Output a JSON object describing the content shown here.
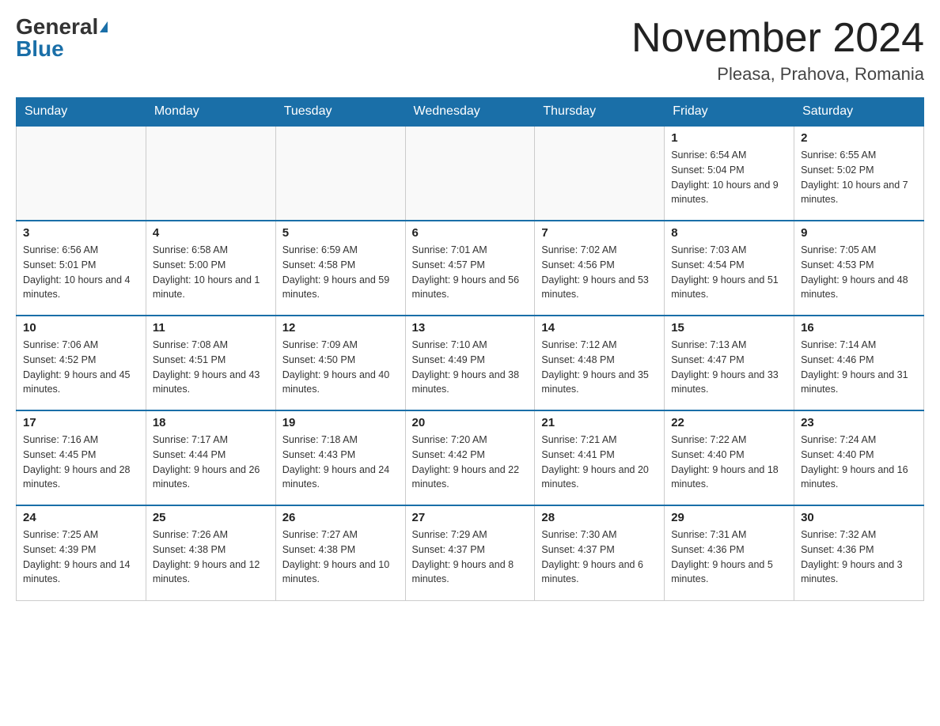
{
  "header": {
    "logo_general": "General",
    "logo_blue": "Blue",
    "month_title": "November 2024",
    "location": "Pleasa, Prahova, Romania"
  },
  "weekdays": [
    "Sunday",
    "Monday",
    "Tuesday",
    "Wednesday",
    "Thursday",
    "Friday",
    "Saturday"
  ],
  "weeks": [
    [
      {
        "day": "",
        "info": ""
      },
      {
        "day": "",
        "info": ""
      },
      {
        "day": "",
        "info": ""
      },
      {
        "day": "",
        "info": ""
      },
      {
        "day": "",
        "info": ""
      },
      {
        "day": "1",
        "info": "Sunrise: 6:54 AM\nSunset: 5:04 PM\nDaylight: 10 hours and 9 minutes."
      },
      {
        "day": "2",
        "info": "Sunrise: 6:55 AM\nSunset: 5:02 PM\nDaylight: 10 hours and 7 minutes."
      }
    ],
    [
      {
        "day": "3",
        "info": "Sunrise: 6:56 AM\nSunset: 5:01 PM\nDaylight: 10 hours and 4 minutes."
      },
      {
        "day": "4",
        "info": "Sunrise: 6:58 AM\nSunset: 5:00 PM\nDaylight: 10 hours and 1 minute."
      },
      {
        "day": "5",
        "info": "Sunrise: 6:59 AM\nSunset: 4:58 PM\nDaylight: 9 hours and 59 minutes."
      },
      {
        "day": "6",
        "info": "Sunrise: 7:01 AM\nSunset: 4:57 PM\nDaylight: 9 hours and 56 minutes."
      },
      {
        "day": "7",
        "info": "Sunrise: 7:02 AM\nSunset: 4:56 PM\nDaylight: 9 hours and 53 minutes."
      },
      {
        "day": "8",
        "info": "Sunrise: 7:03 AM\nSunset: 4:54 PM\nDaylight: 9 hours and 51 minutes."
      },
      {
        "day": "9",
        "info": "Sunrise: 7:05 AM\nSunset: 4:53 PM\nDaylight: 9 hours and 48 minutes."
      }
    ],
    [
      {
        "day": "10",
        "info": "Sunrise: 7:06 AM\nSunset: 4:52 PM\nDaylight: 9 hours and 45 minutes."
      },
      {
        "day": "11",
        "info": "Sunrise: 7:08 AM\nSunset: 4:51 PM\nDaylight: 9 hours and 43 minutes."
      },
      {
        "day": "12",
        "info": "Sunrise: 7:09 AM\nSunset: 4:50 PM\nDaylight: 9 hours and 40 minutes."
      },
      {
        "day": "13",
        "info": "Sunrise: 7:10 AM\nSunset: 4:49 PM\nDaylight: 9 hours and 38 minutes."
      },
      {
        "day": "14",
        "info": "Sunrise: 7:12 AM\nSunset: 4:48 PM\nDaylight: 9 hours and 35 minutes."
      },
      {
        "day": "15",
        "info": "Sunrise: 7:13 AM\nSunset: 4:47 PM\nDaylight: 9 hours and 33 minutes."
      },
      {
        "day": "16",
        "info": "Sunrise: 7:14 AM\nSunset: 4:46 PM\nDaylight: 9 hours and 31 minutes."
      }
    ],
    [
      {
        "day": "17",
        "info": "Sunrise: 7:16 AM\nSunset: 4:45 PM\nDaylight: 9 hours and 28 minutes."
      },
      {
        "day": "18",
        "info": "Sunrise: 7:17 AM\nSunset: 4:44 PM\nDaylight: 9 hours and 26 minutes."
      },
      {
        "day": "19",
        "info": "Sunrise: 7:18 AM\nSunset: 4:43 PM\nDaylight: 9 hours and 24 minutes."
      },
      {
        "day": "20",
        "info": "Sunrise: 7:20 AM\nSunset: 4:42 PM\nDaylight: 9 hours and 22 minutes."
      },
      {
        "day": "21",
        "info": "Sunrise: 7:21 AM\nSunset: 4:41 PM\nDaylight: 9 hours and 20 minutes."
      },
      {
        "day": "22",
        "info": "Sunrise: 7:22 AM\nSunset: 4:40 PM\nDaylight: 9 hours and 18 minutes."
      },
      {
        "day": "23",
        "info": "Sunrise: 7:24 AM\nSunset: 4:40 PM\nDaylight: 9 hours and 16 minutes."
      }
    ],
    [
      {
        "day": "24",
        "info": "Sunrise: 7:25 AM\nSunset: 4:39 PM\nDaylight: 9 hours and 14 minutes."
      },
      {
        "day": "25",
        "info": "Sunrise: 7:26 AM\nSunset: 4:38 PM\nDaylight: 9 hours and 12 minutes."
      },
      {
        "day": "26",
        "info": "Sunrise: 7:27 AM\nSunset: 4:38 PM\nDaylight: 9 hours and 10 minutes."
      },
      {
        "day": "27",
        "info": "Sunrise: 7:29 AM\nSunset: 4:37 PM\nDaylight: 9 hours and 8 minutes."
      },
      {
        "day": "28",
        "info": "Sunrise: 7:30 AM\nSunset: 4:37 PM\nDaylight: 9 hours and 6 minutes."
      },
      {
        "day": "29",
        "info": "Sunrise: 7:31 AM\nSunset: 4:36 PM\nDaylight: 9 hours and 5 minutes."
      },
      {
        "day": "30",
        "info": "Sunrise: 7:32 AM\nSunset: 4:36 PM\nDaylight: 9 hours and 3 minutes."
      }
    ]
  ]
}
